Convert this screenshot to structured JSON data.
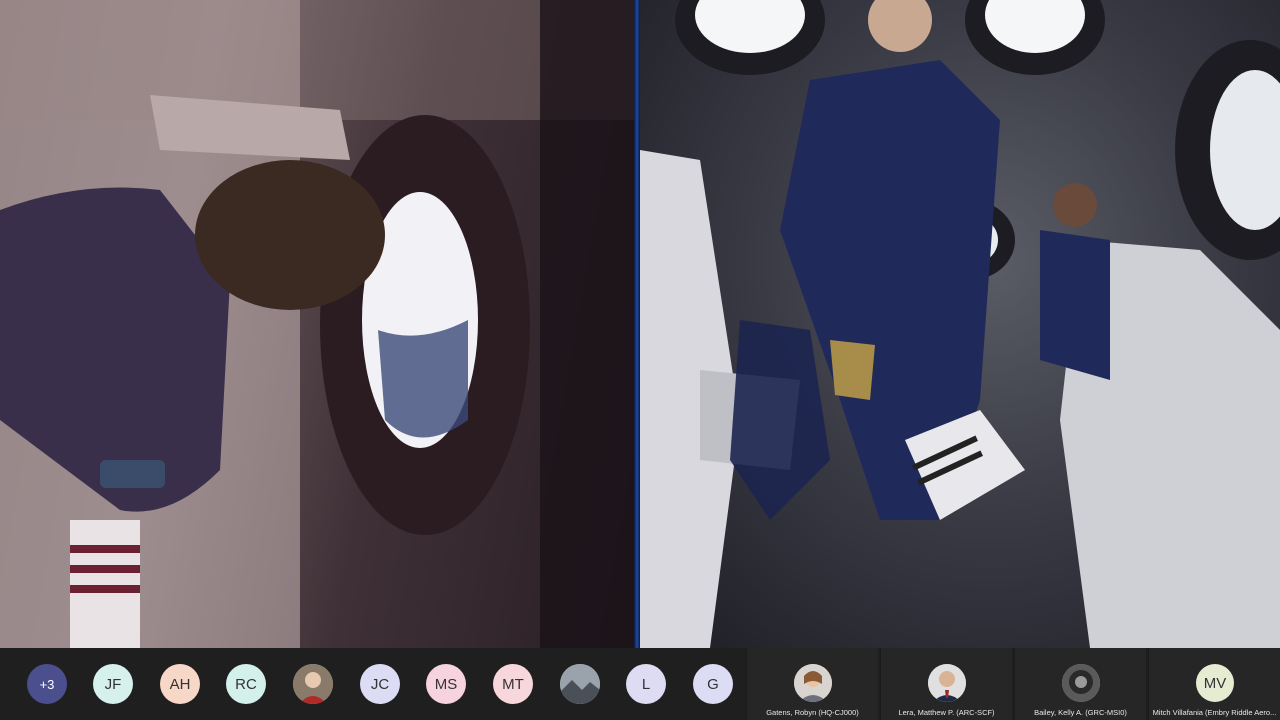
{
  "participants_strip": [
    {
      "kind": "more",
      "label": "+3",
      "bg": "#4b4f8e"
    },
    {
      "kind": "initials",
      "label": "JF",
      "bg": "#d6f0ec"
    },
    {
      "kind": "initials",
      "label": "AH",
      "bg": "#f6d7c8"
    },
    {
      "kind": "initials",
      "label": "RC",
      "bg": "#d4f0ea"
    },
    {
      "kind": "photo",
      "label": ""
    },
    {
      "kind": "initials",
      "label": "JC",
      "bg": "#dcdcf4"
    },
    {
      "kind": "initials",
      "label": "MS",
      "bg": "#f7d3df"
    },
    {
      "kind": "initials",
      "label": "MT",
      "bg": "#f8d7dc"
    },
    {
      "kind": "photo",
      "label": ""
    },
    {
      "kind": "initials",
      "label": "L",
      "bg": "#dedcf2"
    },
    {
      "kind": "initials",
      "label": "G",
      "bg": "#dcdcf4"
    }
  ],
  "tiles": [
    {
      "name": "Gatens, Robyn (HQ-CJ000)",
      "avatar": "photo"
    },
    {
      "name": "Lera, Matthew P. (ARC-SCF)",
      "avatar": "photo"
    },
    {
      "name": "Bailey, Kelly A. (GRC-MSI0)",
      "avatar": "photo"
    },
    {
      "name": "Mitch Villafania (Embry Riddle Aero...",
      "avatar": "initials",
      "initials": "MV",
      "bg": "#e6ecd2"
    }
  ],
  "colors": {
    "bar": "#1f1f1f",
    "tile": "#262626",
    "divider": "#1f4aa8"
  }
}
